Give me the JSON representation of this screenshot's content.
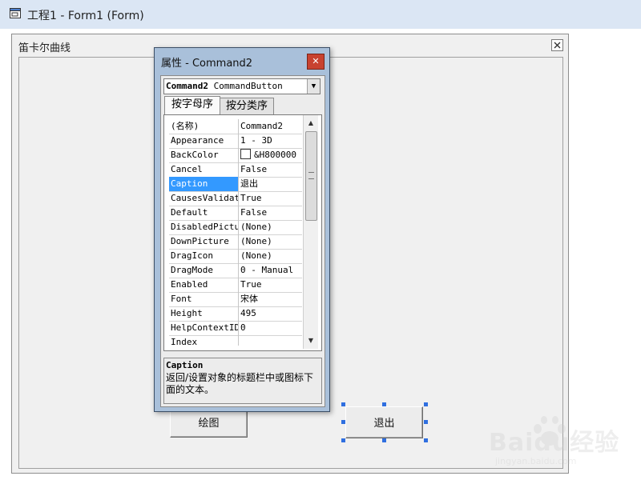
{
  "window": {
    "title": "工程1 - Form1 (Form)"
  },
  "form": {
    "caption": "笛卡尔曲线",
    "buttons": [
      {
        "label": "绘图"
      },
      {
        "label": "退出"
      }
    ]
  },
  "properties": {
    "title": "属性 - Command2",
    "object_name": "Command2",
    "object_type": "CommandButton",
    "tabs": [
      "按字母序",
      "按分类序"
    ],
    "rows": [
      {
        "name": "(名称)",
        "value": "Command2"
      },
      {
        "name": "Appearance",
        "value": "1 - 3D"
      },
      {
        "name": "BackColor",
        "value": "&H800000"
      },
      {
        "name": "Cancel",
        "value": "False"
      },
      {
        "name": "Caption",
        "value": "退出"
      },
      {
        "name": "CausesValidation",
        "value": "True"
      },
      {
        "name": "Default",
        "value": "False"
      },
      {
        "name": "DisabledPicture",
        "value": "(None)"
      },
      {
        "name": "DownPicture",
        "value": "(None)"
      },
      {
        "name": "DragIcon",
        "value": "(None)"
      },
      {
        "name": "DragMode",
        "value": "0 - Manual"
      },
      {
        "name": "Enabled",
        "value": "True"
      },
      {
        "name": "Font",
        "value": "宋体"
      },
      {
        "name": "Height",
        "value": "495"
      },
      {
        "name": "HelpContextID",
        "value": "0"
      },
      {
        "name": "Index",
        "value": ""
      }
    ],
    "selected_row": "Caption",
    "description": {
      "name": "Caption",
      "text": "返回/设置对象的标题栏中或图标下面的文本。"
    }
  },
  "watermark": {
    "brand": "Baidu经验",
    "url": "jingyan.baidu.com"
  },
  "colors": {
    "selection": "#3399ff",
    "close_button": "#c84230",
    "handle": "#2f6fe0"
  }
}
